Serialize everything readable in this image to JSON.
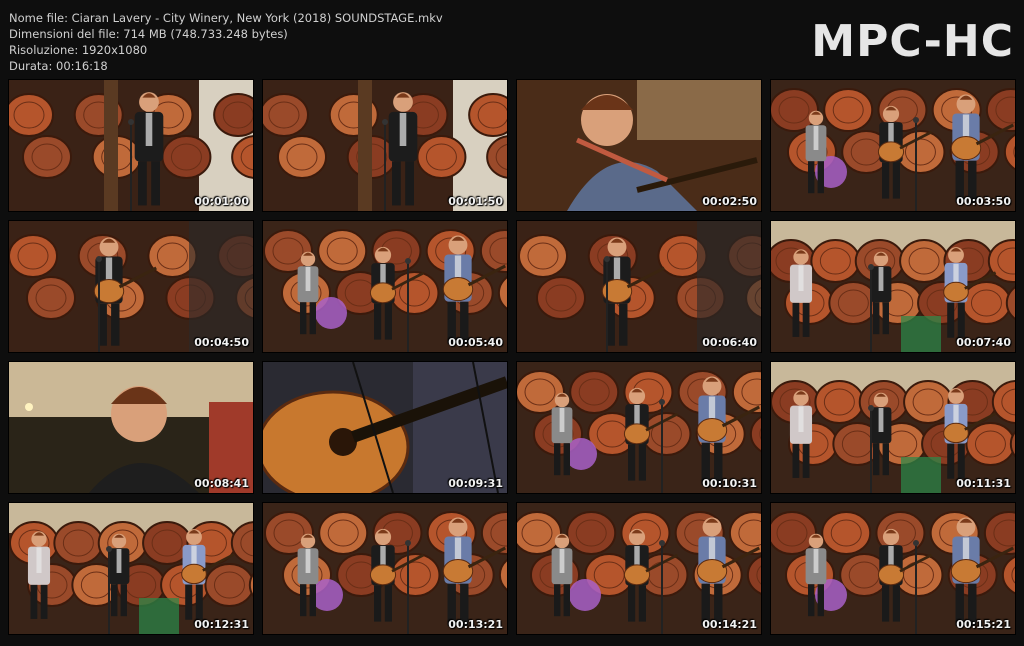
{
  "info": {
    "file_name": "Nome file: Ciaran Lavery - City Winery, New York (2018) SOUNDSTAGE.mkv",
    "file_size": "Dimensioni del file: 714 MB (748.733.248 bytes)",
    "resolution": "Risoluzione: 1920x1080",
    "duration": "Durata: 00:16:18"
  },
  "logo": "MPC-HC",
  "thumbnails": [
    {
      "time": "00:01:00",
      "scene": "solo-wide"
    },
    {
      "time": "00:01:50",
      "scene": "solo-wide"
    },
    {
      "time": "00:02:50",
      "scene": "closeup-guitar"
    },
    {
      "time": "00:03:50",
      "scene": "band-wide"
    },
    {
      "time": "00:04:50",
      "scene": "solo-guitar"
    },
    {
      "time": "00:05:40",
      "scene": "band-wide"
    },
    {
      "time": "00:06:40",
      "scene": "solo-guitar"
    },
    {
      "time": "00:07:40",
      "scene": "band-far"
    },
    {
      "time": "00:08:41",
      "scene": "closeup-face"
    },
    {
      "time": "00:09:31",
      "scene": "guitar-detail"
    },
    {
      "time": "00:10:31",
      "scene": "band-wide"
    },
    {
      "time": "00:11:31",
      "scene": "band-far"
    },
    {
      "time": "00:12:31",
      "scene": "band-far"
    },
    {
      "time": "00:13:21",
      "scene": "band-wide"
    },
    {
      "time": "00:14:21",
      "scene": "band-wide"
    },
    {
      "time": "00:15:21",
      "scene": "band-wide"
    }
  ]
}
